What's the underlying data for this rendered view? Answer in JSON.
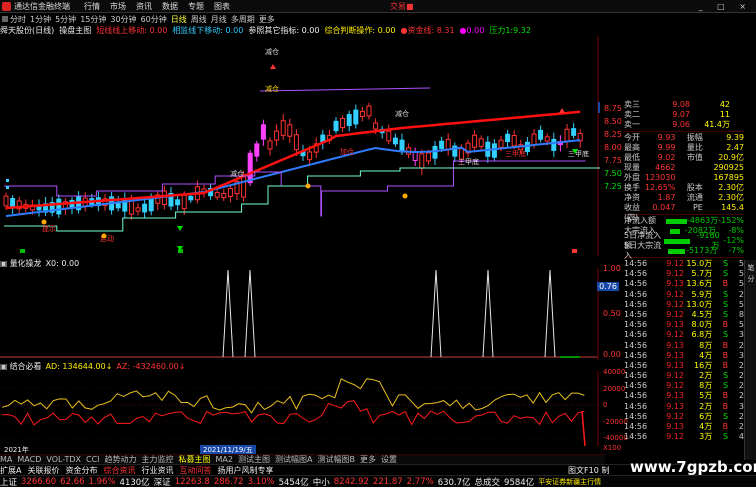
{
  "titlebar": {
    "menus": [
      "行情",
      "市场",
      "资讯",
      "数据",
      "专题",
      "图表"
    ],
    "app_name": "通达信金融终端",
    "brand": "交易■"
  },
  "periodbar": {
    "items": [
      "分时",
      "1分钟",
      "5分钟",
      "15分钟",
      "30分钟",
      "60分钟",
      "日线",
      "周线",
      "月线",
      "多周期",
      "更多"
    ],
    "active": "日线"
  },
  "indline": {
    "stock": "舜天股份(日线)",
    "indicator": "操盘主图",
    "item1": "短线线上移动: 0.00",
    "item2": "相监线下移动: 0.00",
    "item3": "参照其它指标: 0.00",
    "item4": "综合判断操作: 0.00",
    "item5": "●资金线: 8.31",
    "item6": "●0.00",
    "item7": "压力1:9.32"
  },
  "main_chart": {
    "price_axis": [
      "8.75",
      "8.50",
      "8.25",
      "8.00",
      "7.75",
      "7.50",
      "7.25"
    ],
    "annotations": [
      "减仓",
      "减仓",
      "减仓",
      "减仓",
      "加仓",
      "三甲底",
      "三甲底",
      "三甲底",
      "提示",
      "启动"
    ],
    "colors": {
      "up": "#ff3333",
      "down": "#33d0ff",
      "ma_red": "#ff1010",
      "ma_blue": "#3080ff",
      "line_green": "#80ffd0"
    }
  },
  "panel2": {
    "name": "量化操龙",
    "value": "X0: 0.00",
    "axis": [
      "1.00",
      "0.50",
      "0.00"
    ],
    "tag": "0.76"
  },
  "panel3": {
    "name": "结合必看",
    "ad": "AD: 134644.00↓",
    "az": "AZ: -432460.00↓",
    "axis": [
      "40000",
      "20000",
      "0",
      "-20000",
      "-40000",
      "X100"
    ]
  },
  "timeaxis": {
    "start": "2021年",
    "cursor": "2021/11/19/五"
  },
  "quote": {
    "sells": [
      {
        "label": "卖三",
        "price": "9.08",
        "vol": "42"
      },
      {
        "label": "卖二",
        "price": "9.07",
        "vol": "11"
      },
      {
        "label": "卖一",
        "price": "9.06",
        "vol": "41.4万"
      }
    ],
    "stats": [
      {
        "k1": "今开",
        "v1": "9.93",
        "k2": "振幅",
        "v2": "9.39"
      },
      {
        "k1": "最高",
        "v1": "9.99",
        "k2": "量比",
        "v2": "2.47"
      },
      {
        "k1": "最低",
        "v1": "9.02",
        "k2": "市值",
        "v2": "20.9亿"
      },
      {
        "k1": "现量",
        "v1": "4662",
        "k2": "",
        "v2": "290925"
      },
      {
        "k1": "外盘",
        "v1": "123030",
        "k2": "",
        "v2": "167895"
      },
      {
        "k1": "换手",
        "v1": "12.65%",
        "k2": "股本",
        "v2": "2.30亿"
      },
      {
        "k1": "净资",
        "v1": "1.87",
        "k2": "流通",
        "v2": "2.30亿"
      },
      {
        "k1": "收益(四)",
        "v1": "0.047",
        "k2": "PE",
        "v2": "145.4"
      }
    ],
    "flows": [
      {
        "k": "净流入额",
        "v": "-4863万",
        "pct": "-152%",
        "w": 22
      },
      {
        "k": "大宗流入",
        "v": "-2082万",
        "pct": "-8%",
        "w": 10
      },
      {
        "k": "5日净流入额",
        "v": "-9160万",
        "pct": "-12%",
        "w": 30
      },
      {
        "k": "5日大宗流入",
        "v": "-5173万",
        "pct": "-7%",
        "w": 18
      }
    ],
    "ticks": [
      {
        "t": "14:56",
        "p": "9.12",
        "v": "15.0万",
        "d": "S",
        "n": "5"
      },
      {
        "t": "14:56",
        "p": "9.12",
        "v": "5.7万",
        "d": "S",
        "n": "5"
      },
      {
        "t": "14:56",
        "p": "9.13",
        "v": "13.6万",
        "d": "B",
        "n": "5"
      },
      {
        "t": "14:56",
        "p": "9.12",
        "v": "5.9万",
        "d": "S",
        "n": "2"
      },
      {
        "t": "14:56",
        "p": "9.12",
        "v": "13.0万",
        "d": "S",
        "n": "5"
      },
      {
        "t": "14:56",
        "p": "9.12",
        "v": "4.5万",
        "d": "S",
        "n": "8"
      },
      {
        "t": "14:56",
        "p": "9.13",
        "v": "8.0万",
        "d": "B",
        "n": "5"
      },
      {
        "t": "14:56",
        "p": "9.12",
        "v": "6.8万",
        "d": "S",
        "n": "3"
      },
      {
        "t": "14:56",
        "p": "9.13",
        "v": "8万",
        "d": "B",
        "n": "2"
      },
      {
        "t": "14:56",
        "p": "9.13",
        "v": "4万",
        "d": "B",
        "n": "3"
      },
      {
        "t": "14:56",
        "p": "9.13",
        "v": "16万",
        "d": "B",
        "n": "2"
      },
      {
        "t": "14:56",
        "p": "9.12",
        "v": "2万",
        "d": "S",
        "n": "2"
      },
      {
        "t": "14:56",
        "p": "9.12",
        "v": "8万",
        "d": "S",
        "n": "2"
      },
      {
        "t": "14:56",
        "p": "9.13",
        "v": "5万",
        "d": "B",
        "n": "2"
      },
      {
        "t": "14:56",
        "p": "9.13",
        "v": "2万",
        "d": "B",
        "n": "3"
      },
      {
        "t": "14:56",
        "p": "9.12",
        "v": "6万",
        "d": "S",
        "n": "2"
      },
      {
        "t": "14:56",
        "p": "9.13",
        "v": "4万",
        "d": "B",
        "n": "2"
      },
      {
        "t": "14:56",
        "p": "9.12",
        "v": "3万",
        "d": "S",
        "n": "4"
      }
    ]
  },
  "sidestrip": [
    "笔",
    "分"
  ],
  "tabbar": {
    "items": [
      "MA",
      "MACD",
      "VOL-TDX",
      "CCI",
      "趋势动力",
      "主力监控",
      "私募主图",
      "MA2",
      "测试主图",
      "测试幅图A",
      "测试幅图B",
      "更多",
      "设置"
    ],
    "active": "私募主图"
  },
  "infobar": {
    "items": [
      "扩展A",
      "关联报价",
      "资金分布",
      "综合资讯",
      "行业资讯",
      "互动问答",
      "扬用户风制专享"
    ],
    "right": "图文F10 制"
  },
  "statusbar": {
    "sh_label": "上证",
    "sh_val": "3266.60",
    "sh_chg": "62.66",
    "sh_pct": "1.96%",
    "sh_amt": "4130亿",
    "sz_label": "深证",
    "sz_val": "12263.8",
    "sz_chg": "286.72",
    "sz_pct": "3.10%",
    "sz_amt": "5454亿",
    "zx_label": "中小",
    "zx_val": "8242.92",
    "zx_chg": "221.87",
    "zx_pct": "2.77%",
    "zx_amt": "630.7亿",
    "total_label": "总成交",
    "total_val": "9584亿",
    "broker": "平安证券新疆主行情"
  },
  "watermark": "www.7gpzb.com"
}
